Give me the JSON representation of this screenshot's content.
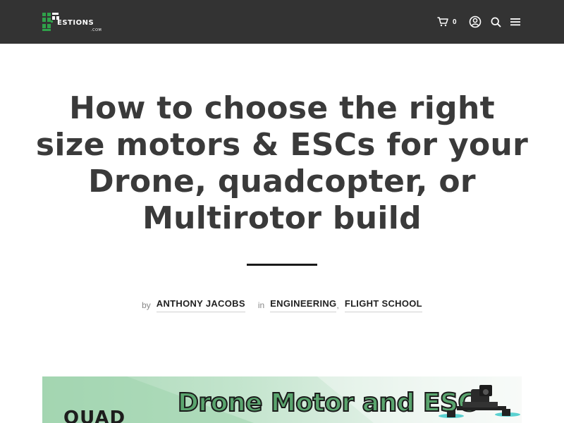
{
  "brand": {
    "logo_text": "ESTIONS",
    "logo_prefix": "AD",
    "logo_suffix": ".COM",
    "accent": "#2fa14a"
  },
  "header": {
    "background": "#333333",
    "cart_count": "0",
    "icons": [
      "cart-icon",
      "account-icon",
      "search-icon",
      "menu-icon"
    ]
  },
  "article": {
    "title": "How to choose the right size motors & ESCs for your Drone, quadcopter, or Multirotor build",
    "by_label": "by",
    "author": "ANTHONY JACOBS",
    "in_label": "in",
    "categories": [
      "ENGINEERING",
      "FLIGHT SCHOOL"
    ],
    "category_separator": ","
  },
  "hero": {
    "title": "Drone Motor and ESC",
    "logo_text": "QUAD"
  }
}
